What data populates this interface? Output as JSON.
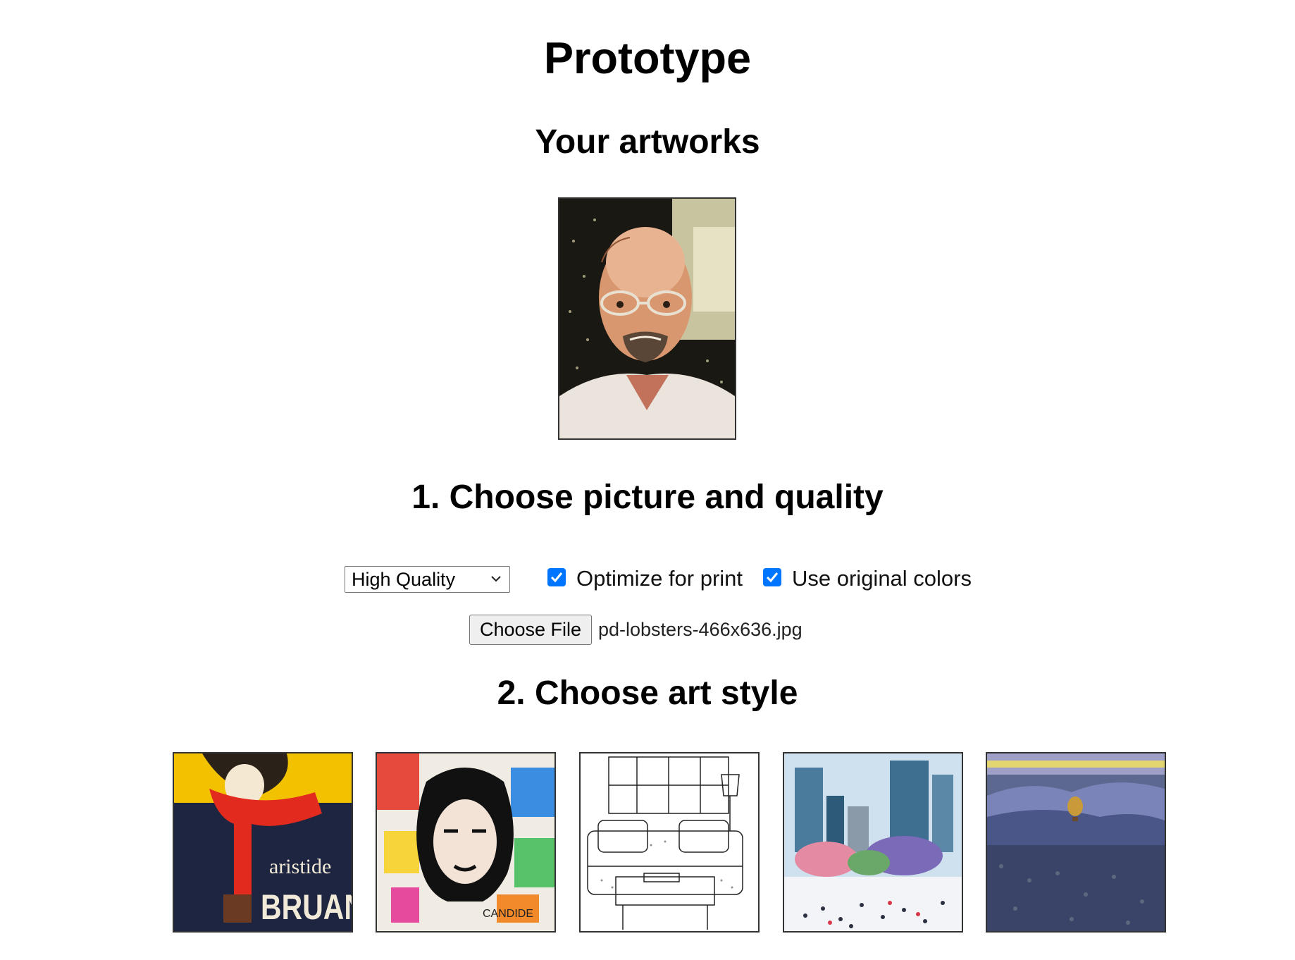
{
  "page": {
    "title": "Prototype"
  },
  "artworks": {
    "heading": "Your artworks",
    "items": [
      {
        "name": "portrait-artwork"
      }
    ]
  },
  "step1": {
    "heading": "1. Choose picture and quality",
    "quality_select": {
      "selected": "High Quality"
    },
    "optimize_print": {
      "label": "Optimize for print",
      "checked": true
    },
    "original_colors": {
      "label": "Use original colors",
      "checked": true
    },
    "file_input": {
      "button_label": "Choose File",
      "file_name": "pd-lobsters-466x636.jpg"
    }
  },
  "step2": {
    "heading": "2. Choose art style",
    "styles": [
      {
        "name": "poster-style",
        "texts": [
          "aristide",
          "BRUANT"
        ]
      },
      {
        "name": "pop-art-style",
        "texts": [
          "CANDIDE"
        ]
      },
      {
        "name": "line-drawing-style"
      },
      {
        "name": "impressionist-city-style"
      },
      {
        "name": "landscape-style"
      }
    ]
  },
  "colors": {
    "checkbox_accent": "#0075ff",
    "poster_red": "#e22b1e",
    "poster_yellow": "#f2c200",
    "poster_navy": "#1d2540"
  }
}
